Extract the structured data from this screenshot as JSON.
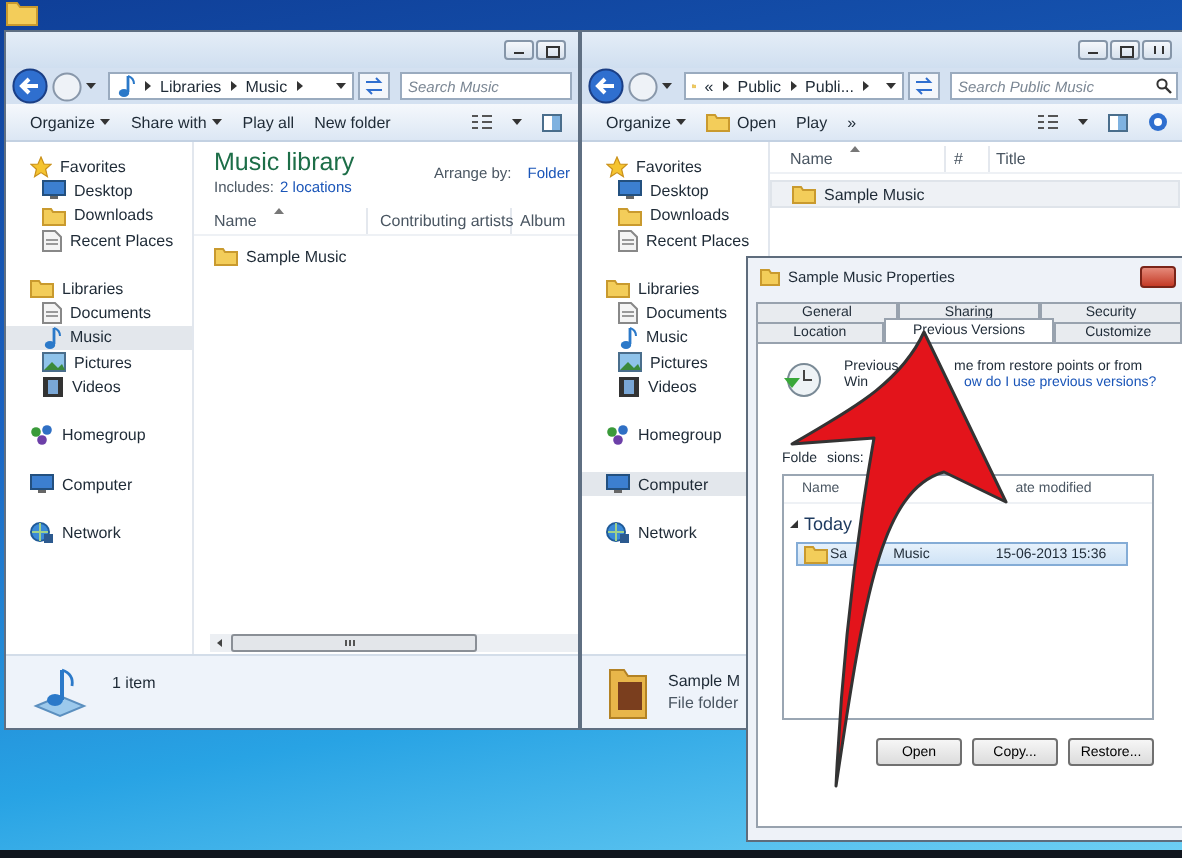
{
  "library_window": {
    "address": {
      "segments": [
        "Libraries",
        "Music"
      ]
    },
    "search": {
      "placeholder": "Search Music"
    },
    "toolbar": [
      {
        "label": "Organize",
        "kind": "menu"
      },
      {
        "label": "Share with",
        "kind": "menu"
      },
      {
        "label": "Play all",
        "kind": "button"
      },
      {
        "label": "New folder",
        "kind": "button"
      }
    ],
    "nav": [
      {
        "label": "Favorites",
        "selected": false,
        "children": [
          {
            "label": "Desktop",
            "selected": false
          },
          {
            "label": "Downloads",
            "selected": false
          },
          {
            "label": "Recent Places",
            "selected": false
          }
        ]
      },
      {
        "label": "Libraries",
        "selected": false,
        "children": [
          {
            "label": "Documents",
            "selected": false
          },
          {
            "label": "Music",
            "selected": true
          },
          {
            "label": "Pictures",
            "selected": false
          },
          {
            "label": "Videos",
            "selected": false
          }
        ]
      },
      {
        "label": "Homegroup",
        "selected": false
      },
      {
        "label": "Computer",
        "selected": false
      },
      {
        "label": "Network",
        "selected": false
      }
    ],
    "library_title": "Music library",
    "includes": {
      "label": "Includes:",
      "link": "2 locations"
    },
    "arrange_by": {
      "label": "Arrange by:",
      "value": "Folder"
    },
    "columns": [
      "Name",
      "Contributing artists",
      "Album"
    ],
    "rows": [
      {
        "name": "Sample Music",
        "selected": false
      }
    ],
    "status": "1 item"
  },
  "public_window": {
    "address": {
      "prefix": "«",
      "segments": [
        "Public",
        "Publi..."
      ]
    },
    "search": {
      "placeholder": "Search Public Music"
    },
    "toolbar": [
      {
        "label": "Organize",
        "kind": "menu"
      },
      {
        "label": "Open",
        "kind": "icon_button"
      },
      {
        "label": "Play",
        "kind": "button"
      },
      {
        "label": "»",
        "kind": "button"
      }
    ],
    "nav": [
      {
        "label": "Favorites",
        "selected": false,
        "children": [
          {
            "label": "Desktop",
            "selected": false
          },
          {
            "label": "Downloads",
            "selected": false
          },
          {
            "label": "Recent Places",
            "selected": false
          }
        ]
      },
      {
        "label": "Libraries",
        "selected": false,
        "children": [
          {
            "label": "Documents",
            "selected": false
          },
          {
            "label": "Music",
            "selected": false
          },
          {
            "label": "Pictures",
            "selected": false
          },
          {
            "label": "Videos",
            "selected": false
          }
        ]
      },
      {
        "label": "Homegroup",
        "selected": false
      },
      {
        "label": "Computer",
        "selected": true
      },
      {
        "label": "Network",
        "selected": false
      }
    ],
    "columns": [
      "Name",
      "#",
      "Title"
    ],
    "rows": [
      {
        "name": "Sample Music",
        "selected": true
      }
    ],
    "details": {
      "name": "Sample M",
      "type": "File folder"
    }
  },
  "properties_dialog": {
    "title": "Sample Music Properties",
    "tab_rows": [
      [
        {
          "label": "General",
          "selected": false
        },
        {
          "label": "Sharing",
          "selected": false
        },
        {
          "label": "Security",
          "selected": false
        }
      ],
      [
        {
          "label": "Location",
          "selected": false
        },
        {
          "label": "Previous Versions",
          "selected": true
        },
        {
          "label": "Customize",
          "selected": false
        }
      ]
    ],
    "info_line_1": [
      "Previous",
      "me from restore points or from"
    ],
    "info_line_2": {
      "text": "Win",
      "link": "ow do I use previous versions?"
    },
    "versions_label": [
      "Folde",
      "sions:"
    ],
    "list": {
      "columns": [
        "Name",
        "ate modified"
      ],
      "group": "Today",
      "rows": [
        {
          "name": [
            "Sa",
            "Music"
          ],
          "date": "15-06-2013 15:36",
          "selected": true
        }
      ]
    },
    "buttons": [
      "Open",
      "Copy...",
      "Restore..."
    ]
  }
}
